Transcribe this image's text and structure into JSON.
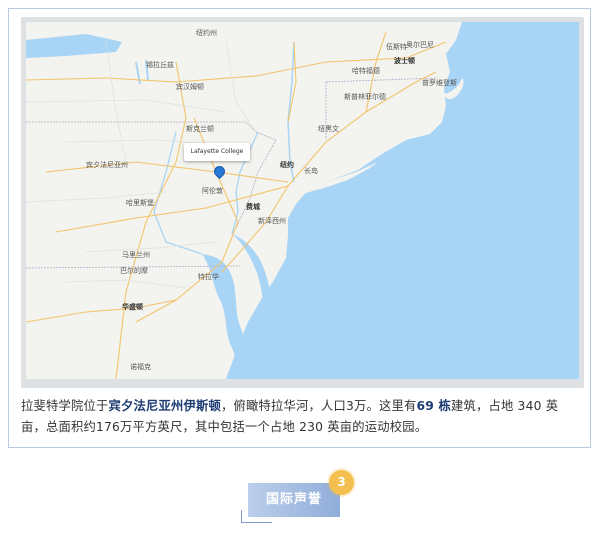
{
  "map": {
    "marker_label": "Lafayette College",
    "places": [
      {
        "name": "纽约州",
        "kind": "place"
      },
      {
        "name": "锡拉丘兹",
        "kind": "place"
      },
      {
        "name": "奥尔巴尼",
        "kind": "place"
      },
      {
        "name": "宾汉姆顿",
        "kind": "place"
      },
      {
        "name": "斯克兰顿",
        "kind": "place"
      },
      {
        "name": "新泽西州",
        "kind": "place"
      },
      {
        "name": "纽约",
        "kind": "city"
      },
      {
        "name": "费城",
        "kind": "city"
      },
      {
        "name": "阿伦敦",
        "kind": "place"
      },
      {
        "name": "哈里斯堡",
        "kind": "place"
      },
      {
        "name": "巴尔的摩",
        "kind": "place"
      },
      {
        "name": "华盛顿",
        "kind": "city"
      },
      {
        "name": "哈特福德",
        "kind": "place"
      },
      {
        "name": "波士顿",
        "kind": "city"
      },
      {
        "name": "普罗维登斯",
        "kind": "place"
      },
      {
        "name": "纽黑文",
        "kind": "place"
      },
      {
        "name": "宾夕法尼亚州",
        "kind": "place"
      },
      {
        "name": "马里兰州",
        "kind": "place"
      },
      {
        "name": "特拉华",
        "kind": "place"
      },
      {
        "name": "长岛",
        "kind": "place"
      },
      {
        "name": "伍斯特",
        "kind": "place"
      },
      {
        "name": "斯普林菲尔德",
        "kind": "place"
      },
      {
        "name": "诺福克",
        "kind": "place"
      }
    ]
  },
  "caption": {
    "part1": "拉斐特学院位于",
    "state": "宾夕法尼亚州伊斯顿",
    "part2": "，俯瞰特拉华河，人口3万。这里有",
    "buildings": "69 栋",
    "part3": "建筑，占地 340 英亩，总面积约176万平方英尺，其中包括一个占地 230 英亩的运动校园。"
  },
  "section": {
    "number": "3",
    "title": "国际声誉"
  },
  "colors": {
    "water": "#a8d4f5",
    "land": "#f3f3ef",
    "accent_badge": "#f3bf4e",
    "tag_gradient_start": "#bccfec",
    "tag_gradient_end": "#8fadd9",
    "emphasis_text": "#1d3d72"
  }
}
